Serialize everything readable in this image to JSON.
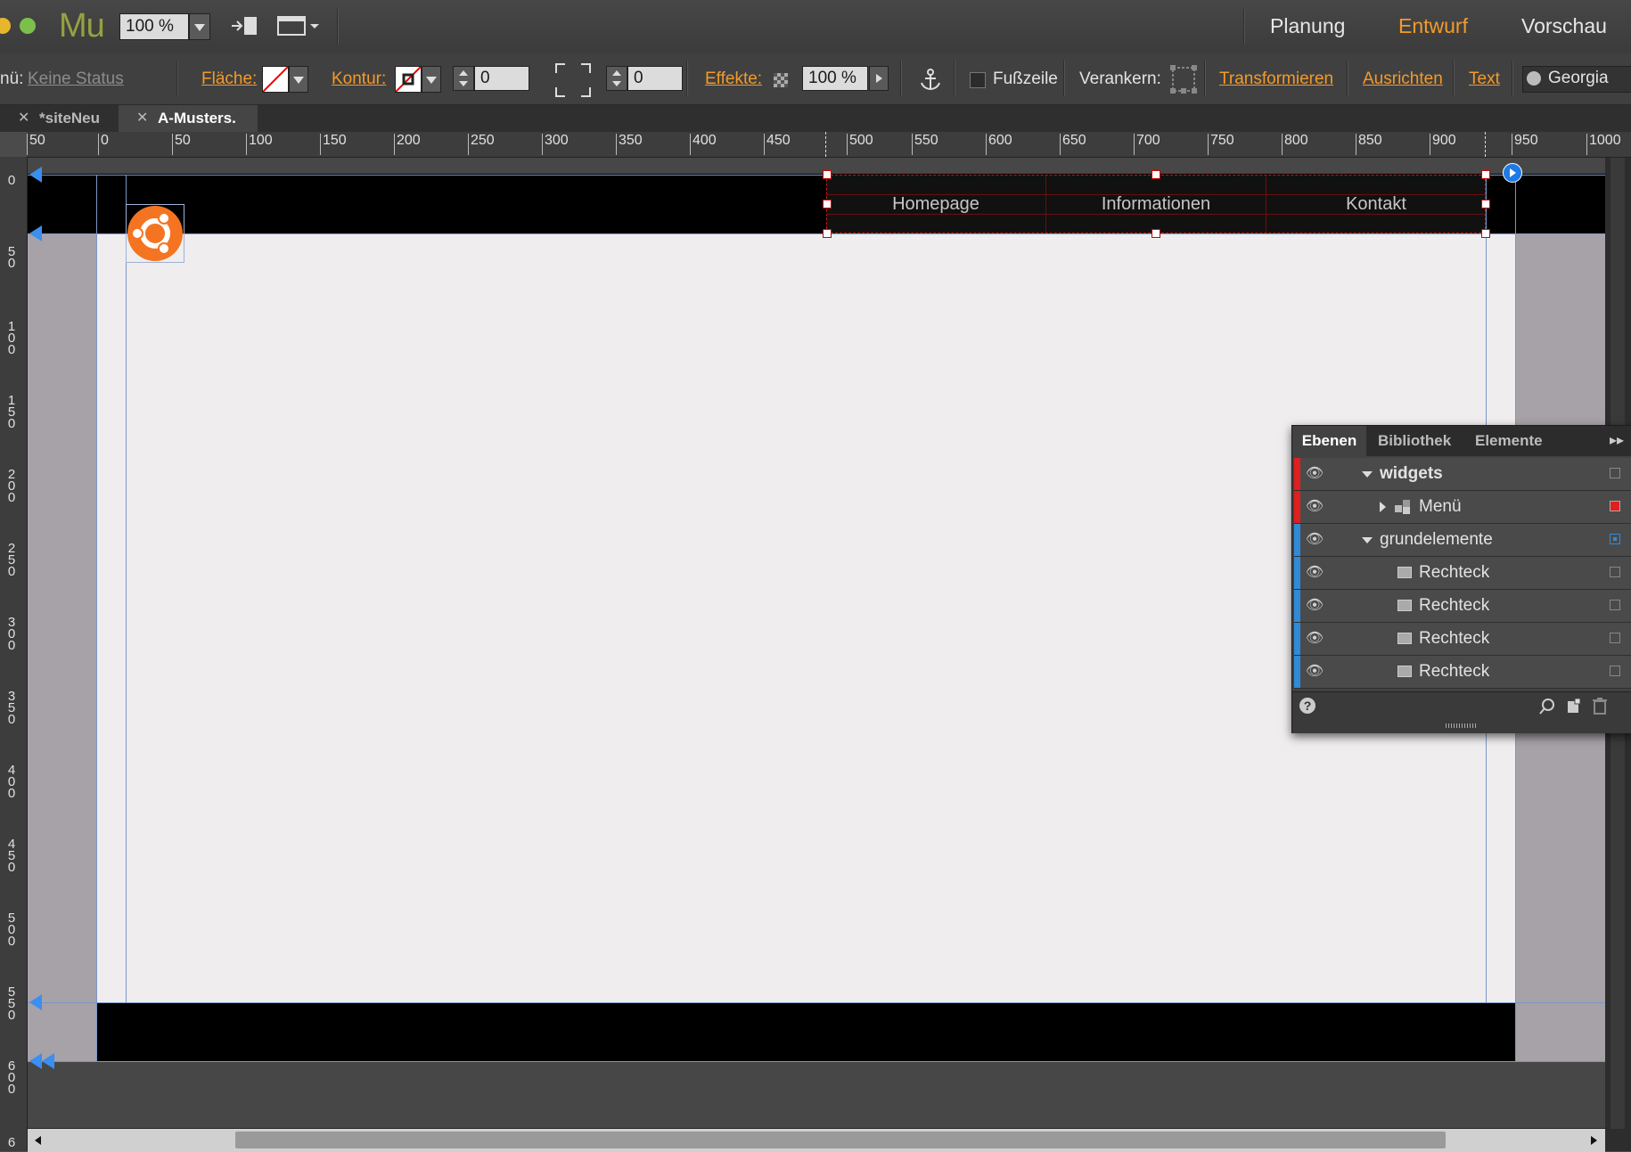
{
  "app": {
    "logo": "Mu",
    "zoom": "100 %"
  },
  "workspace": {
    "tabs": [
      "Planung",
      "Entwurf",
      "Vorschau"
    ],
    "active": "Entwurf"
  },
  "controls": {
    "status_label": "nü:",
    "status_value": "Keine Status",
    "fill_label": "Fläche:",
    "stroke_label": "Kontur:",
    "stroke_width": "0",
    "corner_radius": "0",
    "effects_label": "Effekte:",
    "opacity": "100 %",
    "footer_label": "Fußzeile",
    "anchor_label": "Verankern:",
    "transform_label": "Transformieren",
    "align_label": "Ausrichten",
    "text_label": "Text",
    "font_value": "Georgia"
  },
  "doc_tabs": [
    {
      "label": "*siteNeu",
      "active": false
    },
    {
      "label": "A-Musters.",
      "active": true
    }
  ],
  "ruler": {
    "h_ticks": [
      "50",
      "0",
      "50",
      "100",
      "150",
      "200",
      "250",
      "300",
      "350",
      "400",
      "450",
      "500",
      "550",
      "600",
      "650",
      "700",
      "750",
      "800",
      "850",
      "900",
      "950",
      "1000"
    ],
    "v_ticks": [
      "0",
      "50",
      "100",
      "150",
      "200",
      "250",
      "300",
      "350",
      "400",
      "450",
      "500",
      "550",
      "600",
      "6"
    ]
  },
  "page": {
    "menu_items": [
      "Homepage",
      "Informationen",
      "Kontakt"
    ],
    "colors": {
      "header": "#000000",
      "content": "#efedee",
      "margin": "#a7a2a8",
      "logo": "#f47421"
    }
  },
  "layers_panel": {
    "tabs": [
      "Ebenen",
      "Bibliothek",
      "Elemente"
    ],
    "active_tab": "Ebenen",
    "layers": [
      {
        "name": "widgets",
        "level": 0,
        "color": "#e01f1f",
        "expanded": true
      },
      {
        "name": "Menü",
        "level": 1,
        "color": "#e01f1f",
        "expanded": false
      },
      {
        "name": "grundelemente",
        "level": 0,
        "color": "#2f8ad8",
        "expanded": true
      },
      {
        "name": "Rechteck",
        "level": 1,
        "color": "#2f8ad8"
      },
      {
        "name": "Rechteck",
        "level": 1,
        "color": "#2f8ad8"
      },
      {
        "name": "Rechteck",
        "level": 1,
        "color": "#2f8ad8"
      },
      {
        "name": "Rechteck",
        "level": 1,
        "color": "#2f8ad8"
      }
    ]
  }
}
